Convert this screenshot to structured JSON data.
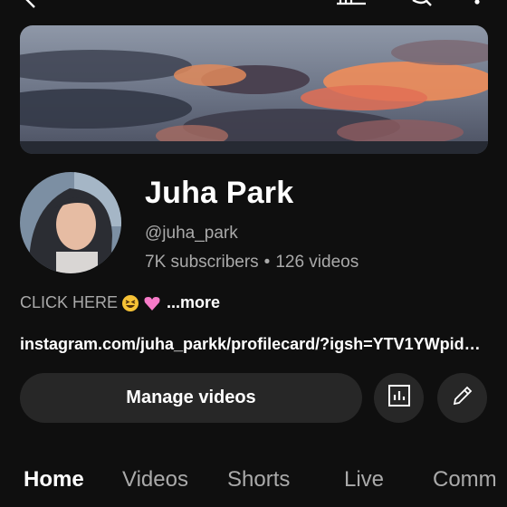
{
  "icons": {
    "back": "arrow-back-icon",
    "cast": "cast-icon",
    "search": "search-icon",
    "more": "more-vert-icon",
    "analytics": "analytics-icon",
    "edit": "pencil-icon",
    "emoji_1": "grinning-squint-emoji",
    "emoji_2": "pink-heart-emoji"
  },
  "channel": {
    "name": "Juha Park",
    "handle": "@juha_park",
    "subscribers": "7K subscribers",
    "separator": "•",
    "videos": "126 videos",
    "description": "CLICK HERE",
    "more_label": "...more",
    "link": "instagram.com/juha_parkk/profilecard/?igsh=YTV1YWpid…"
  },
  "actions": {
    "manage_label": "Manage videos"
  },
  "tabs": [
    {
      "label": "Home",
      "active": true
    },
    {
      "label": "Videos",
      "active": false
    },
    {
      "label": "Shorts",
      "active": false
    },
    {
      "label": "Live",
      "active": false
    },
    {
      "label": "Comm",
      "active": false
    }
  ],
  "colors": {
    "background": "#0f0f0f",
    "button_bg": "#272727",
    "secondary_text": "#aaaaaa",
    "primary_text": "#ffffff"
  }
}
